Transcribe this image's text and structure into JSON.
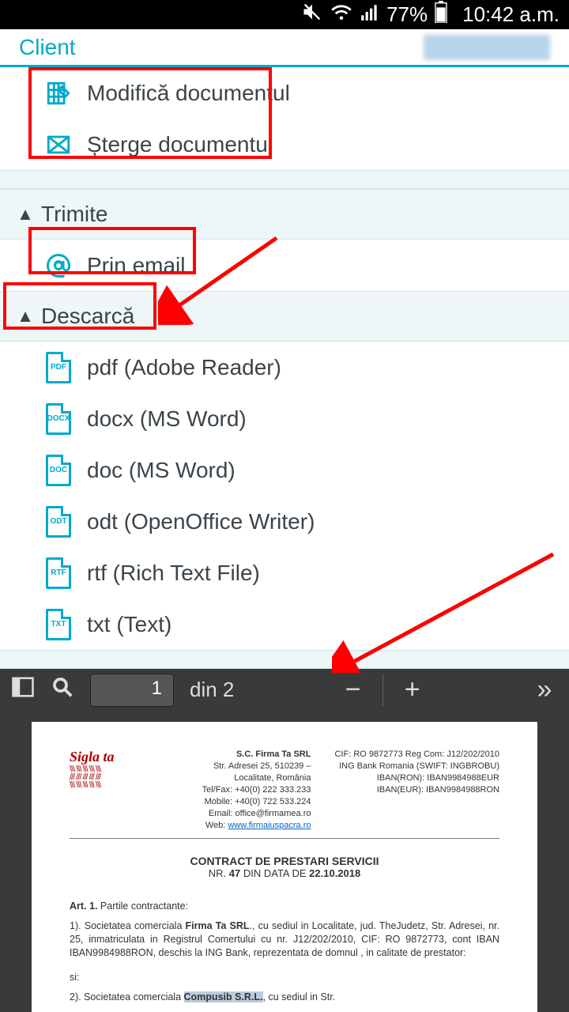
{
  "status": {
    "battery_pct": "77%",
    "time": "10:42 a.m."
  },
  "header": {
    "client_label": "Client"
  },
  "menu": {
    "edit_doc": "Modifică documentul",
    "delete_doc": "Șterge documentul",
    "send_section": "Trimite",
    "send_email": "Prin email",
    "download_section": "Descarcă",
    "formats": {
      "pdf": {
        "badge": "PDF",
        "label": "pdf (Adobe Reader)"
      },
      "docx": {
        "badge": "DOCX",
        "label": "docx (MS Word)"
      },
      "doc": {
        "badge": "DOC",
        "label": "doc (MS Word)"
      },
      "odt": {
        "badge": "ODT",
        "label": "odt (OpenOffice Writer)"
      },
      "rtf": {
        "badge": "RTF",
        "label": "rtf (Rich Text File)"
      },
      "txt": {
        "badge": "TXT",
        "label": "txt (Text)"
      }
    }
  },
  "pdf_toolbar": {
    "page_current": "1",
    "page_total_label": "din 2"
  },
  "doc": {
    "logo_line1": "Sigla ta",
    "company_name": "S.C. Firma Ta SRL",
    "addr": "Str. Adresei 25, 510239 – Localitate, România",
    "telfax": "Tel/Fax: +40(0) 222 333.233",
    "mobile": "Mobile: +40(0) 722 533.224",
    "email": "Email: office@firmamea.ro",
    "web_label": "Web: ",
    "web_link": "www.firmaiuspacra.ro",
    "bank_cif": "CIF: RO 9872773  Reg Com: J12/202/2010",
    "bank_name": "ING Bank Romania (SWIFT: INGBROBU)",
    "bank_ron": "IBAN(RON): IBAN9984988EUR",
    "bank_eur": "IBAN(EUR): IBAN9984988RON",
    "title": "CONTRACT DE PRESTARI SERVICII",
    "subtitle_pre": "NR. ",
    "subtitle_nr": "47",
    "subtitle_mid": " DIN DATA DE ",
    "subtitle_date": "22.10.2018",
    "art1_label": "Art. 1.",
    "art1_text": " Partile contractante:",
    "p1_pre": "1). Societatea comerciala ",
    "p1_firm": "Firma Ta SRL",
    "p1_rest": "., cu sediul in Localitate, jud. TheJudetz, Str. Adresei, nr. 25, inmatriculata in Registrul Comertului cu nr. J12/202/2010, CIF: RO 9872773, cont IBAN IBAN9984988RON, deschis la ING Bank, reprezentata de domnul , in calitate de prestator:",
    "si": "si:",
    "p2_pre": "2). Societatea comerciala ",
    "p2_firm": "Compusib S.R.L.",
    "p2_rest": ", cu sediul in  Str. "
  }
}
